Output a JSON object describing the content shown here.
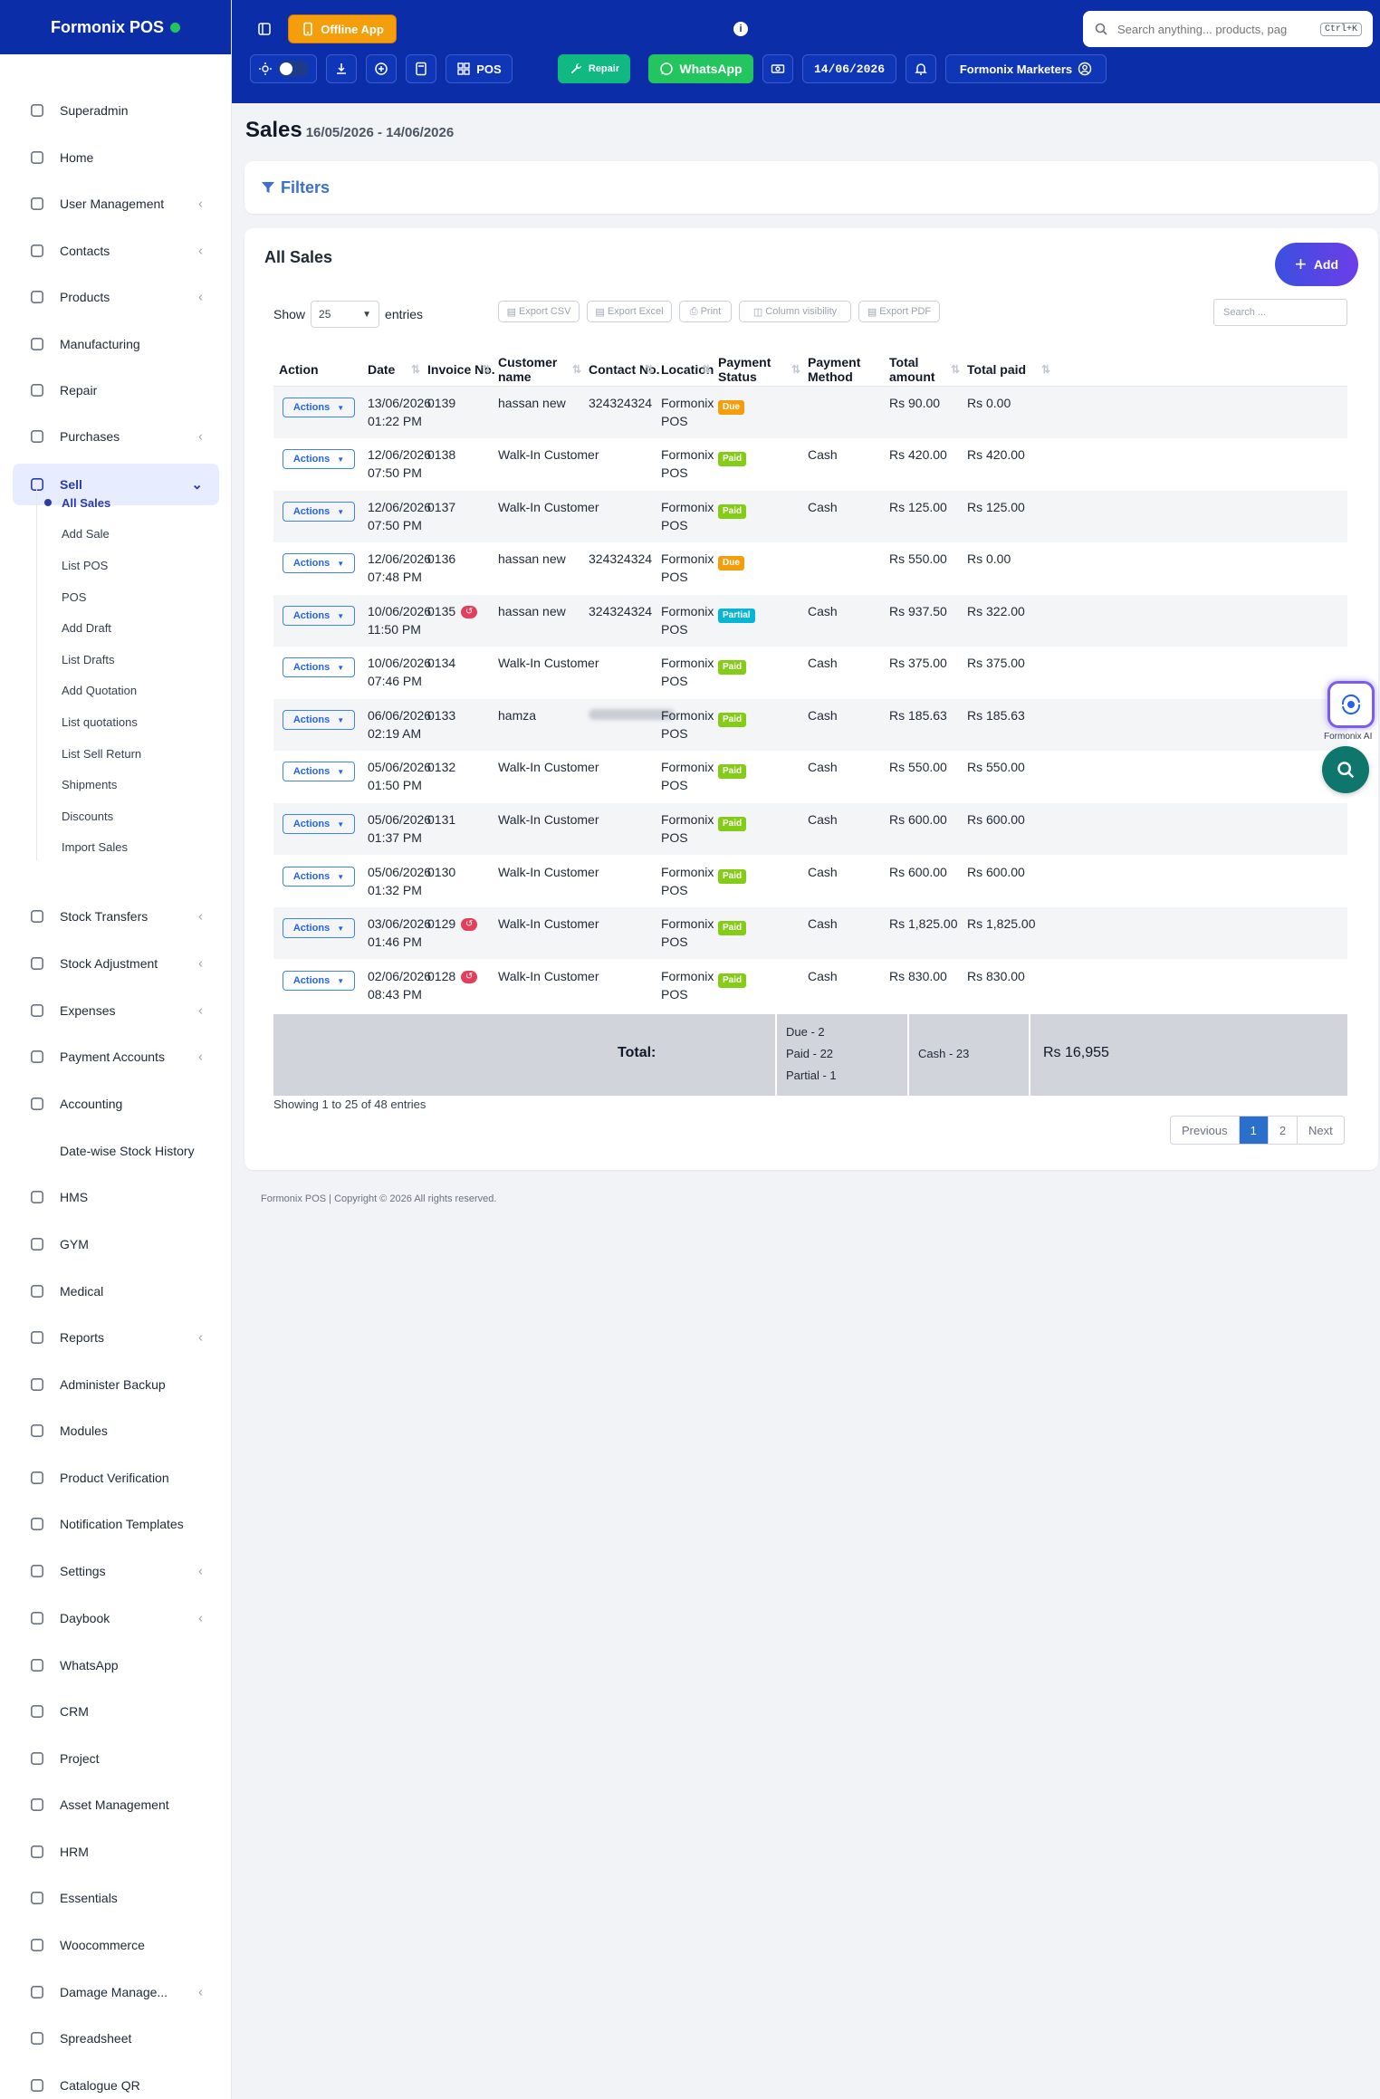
{
  "brand": "Formonix POS",
  "sidebar": {
    "items": [
      {
        "label": "Superadmin",
        "icon": "user-icon",
        "chev": false
      },
      {
        "label": "Home",
        "icon": "home-icon",
        "chev": false
      },
      {
        "label": "User Management",
        "icon": "users-icon",
        "chev": true
      },
      {
        "label": "Contacts",
        "icon": "contacts-icon",
        "chev": true
      },
      {
        "label": "Products",
        "icon": "box-icon",
        "chev": true
      },
      {
        "label": "Manufacturing",
        "icon": "factory-icon",
        "chev": false
      },
      {
        "label": "Repair",
        "icon": "wrench-icon",
        "chev": false
      },
      {
        "label": "Purchases",
        "icon": "download-icon",
        "chev": true
      },
      {
        "label": "Sell",
        "icon": "anchor-icon",
        "chev": true
      },
      {
        "label": "Stock Transfers",
        "icon": "truck-icon",
        "chev": true
      },
      {
        "label": "Stock Adjustment",
        "icon": "database-icon",
        "chev": true
      },
      {
        "label": "Expenses",
        "icon": "receipt-icon",
        "chev": true
      },
      {
        "label": "Payment Accounts",
        "icon": "card-icon",
        "chev": true
      },
      {
        "label": "Accounting",
        "icon": "bank-icon",
        "chev": false
      },
      {
        "label": "Date-wise Stock History",
        "icon": "none",
        "chev": false
      },
      {
        "label": "HMS",
        "icon": "building-icon",
        "chev": false
      },
      {
        "label": "GYM",
        "icon": "dumbbell-icon",
        "chev": false
      },
      {
        "label": "Medical",
        "icon": "medical-icon",
        "chev": false
      },
      {
        "label": "Reports",
        "icon": "report-icon",
        "chev": true
      },
      {
        "label": "Administer Backup",
        "icon": "cloud-icon",
        "chev": false
      },
      {
        "label": "Modules",
        "icon": "layers-icon",
        "chev": false
      },
      {
        "label": "Product Verification",
        "icon": "grid-icon",
        "chev": false
      },
      {
        "label": "Notification Templates",
        "icon": "mail-icon",
        "chev": false
      },
      {
        "label": "Settings",
        "icon": "gear-icon",
        "chev": true
      },
      {
        "label": "Daybook",
        "icon": "book-icon",
        "chev": true
      },
      {
        "label": "WhatsApp",
        "icon": "whatsapp-icon",
        "chev": false
      },
      {
        "label": "CRM",
        "icon": "broadcast-icon",
        "chev": false
      },
      {
        "label": "Project",
        "icon": "project-icon",
        "chev": false
      },
      {
        "label": "Asset Management",
        "icon": "asset-icon",
        "chev": false
      },
      {
        "label": "HRM",
        "icon": "people-icon",
        "chev": false
      },
      {
        "label": "Essentials",
        "icon": "check-circle-icon",
        "chev": false
      },
      {
        "label": "Woocommerce",
        "icon": "wordpress-icon",
        "chev": false
      },
      {
        "label": "Damage Manage...",
        "icon": "warning-icon",
        "chev": true
      },
      {
        "label": "Spreadsheet",
        "icon": "sheet-icon",
        "chev": false
      },
      {
        "label": "Catalogue QR",
        "icon": "qr-icon",
        "chev": false
      }
    ],
    "sell_sub": [
      "All Sales",
      "Add Sale",
      "List POS",
      "POS",
      "Add Draft",
      "List Drafts",
      "Add Quotation",
      "List quotations",
      "List Sell Return",
      "Shipments",
      "Discounts",
      "Import Sales"
    ]
  },
  "topbar": {
    "offline_app": "Offline App",
    "pos": "POS",
    "repair": "Repair",
    "whatsapp": "WhatsApp",
    "date": "14/06/2026",
    "business": "Formonix Marketers",
    "search_placeholder": "Search anything... products, pag",
    "search_kbd": "Ctrl+K"
  },
  "page": {
    "title": "Sales",
    "range": "16/05/2026 - 14/06/2026",
    "filters": "Filters",
    "card_title": "All Sales",
    "add": "Add",
    "show": "Show",
    "entries_value": "25",
    "entries": "entries",
    "exports": [
      "Export CSV",
      "Export Excel",
      "Print",
      "Column visibility",
      "Export PDF"
    ],
    "table_search_placeholder": "Search ..."
  },
  "table": {
    "headers": [
      "Action",
      "Date",
      "Invoice No.",
      "Customer name",
      "Contact No.",
      "Location",
      "Payment Status",
      "Payment Method",
      "Total amount",
      "Total paid"
    ],
    "action_label": "Actions",
    "rows": [
      {
        "date1": "13/06/2026",
        "date2": "01:22 PM",
        "inv": "0139",
        "ret": false,
        "cust": "hassan new",
        "contact": "324324324",
        "blur": false,
        "loc1": "Formonix",
        "loc2": "POS",
        "status": "Due",
        "method": "",
        "total": "Rs 90.00",
        "paid": "Rs 0.00"
      },
      {
        "date1": "12/06/2026",
        "date2": "07:50 PM",
        "inv": "0138",
        "ret": false,
        "cust": "Walk-In Customer",
        "contact": "",
        "blur": false,
        "loc1": "Formonix",
        "loc2": "POS",
        "status": "Paid",
        "method": "Cash",
        "total": "Rs 420.00",
        "paid": "Rs 420.00"
      },
      {
        "date1": "12/06/2026",
        "date2": "07:50 PM",
        "inv": "0137",
        "ret": false,
        "cust": "Walk-In Customer",
        "contact": "",
        "blur": false,
        "loc1": "Formonix",
        "loc2": "POS",
        "status": "Paid",
        "method": "Cash",
        "total": "Rs 125.00",
        "paid": "Rs 125.00"
      },
      {
        "date1": "12/06/2026",
        "date2": "07:48 PM",
        "inv": "0136",
        "ret": false,
        "cust": "hassan new",
        "contact": "324324324",
        "blur": false,
        "loc1": "Formonix",
        "loc2": "POS",
        "status": "Due",
        "method": "",
        "total": "Rs 550.00",
        "paid": "Rs 0.00"
      },
      {
        "date1": "10/06/2026",
        "date2": "11:50 PM",
        "inv": "0135",
        "ret": true,
        "cust": "hassan new",
        "contact": "324324324",
        "blur": false,
        "loc1": "Formonix",
        "loc2": "POS",
        "status": "Partial",
        "method": "Cash",
        "total": "Rs 937.50",
        "paid": "Rs 322.00"
      },
      {
        "date1": "10/06/2026",
        "date2": "07:46 PM",
        "inv": "0134",
        "ret": false,
        "cust": "Walk-In Customer",
        "contact": "",
        "blur": false,
        "loc1": "Formonix",
        "loc2": "POS",
        "status": "Paid",
        "method": "Cash",
        "total": "Rs 375.00",
        "paid": "Rs 375.00"
      },
      {
        "date1": "06/06/2026",
        "date2": "02:19 AM",
        "inv": "0133",
        "ret": false,
        "cust": "hamza",
        "contact": "",
        "blur": true,
        "loc1": "Formonix",
        "loc2": "POS",
        "status": "Paid",
        "method": "Cash",
        "total": "Rs 185.63",
        "paid": "Rs 185.63"
      },
      {
        "date1": "05/06/2026",
        "date2": "01:50 PM",
        "inv": "0132",
        "ret": false,
        "cust": "Walk-In Customer",
        "contact": "",
        "blur": false,
        "loc1": "Formonix",
        "loc2": "POS",
        "status": "Paid",
        "method": "Cash",
        "total": "Rs 550.00",
        "paid": "Rs 550.00"
      },
      {
        "date1": "05/06/2026",
        "date2": "01:37 PM",
        "inv": "0131",
        "ret": false,
        "cust": "Walk-In Customer",
        "contact": "",
        "blur": false,
        "loc1": "Formonix",
        "loc2": "POS",
        "status": "Paid",
        "method": "Cash",
        "total": "Rs 600.00",
        "paid": "Rs 600.00"
      },
      {
        "date1": "05/06/2026",
        "date2": "01:32 PM",
        "inv": "0130",
        "ret": false,
        "cust": "Walk-In Customer",
        "contact": "",
        "blur": false,
        "loc1": "Formonix",
        "loc2": "POS",
        "status": "Paid",
        "method": "Cash",
        "total": "Rs 600.00",
        "paid": "Rs 600.00"
      },
      {
        "date1": "03/06/2026",
        "date2": "01:46 PM",
        "inv": "0129",
        "ret": true,
        "cust": "Walk-In Customer",
        "contact": "",
        "blur": false,
        "loc1": "Formonix",
        "loc2": "POS",
        "status": "Paid",
        "method": "Cash",
        "total": "Rs 1,825.00",
        "paid": "Rs 1,825.00"
      },
      {
        "date1": "02/06/2026",
        "date2": "08:43 PM",
        "inv": "0128",
        "ret": true,
        "cust": "Walk-In Customer",
        "contact": "",
        "blur": false,
        "loc1": "Formonix",
        "loc2": "POS",
        "status": "Paid",
        "method": "Cash",
        "total": "Rs 830.00",
        "paid": "Rs 830.00"
      }
    ],
    "total_label": "Total:",
    "totals_status": [
      "Due - 2",
      "Paid - 22",
      "Partial - 1"
    ],
    "totals_method": "Cash - 23",
    "totals_amount": "Rs 16,955"
  },
  "pagination": {
    "info": "Showing 1 to 25 of 48 entries",
    "previous": "Previous",
    "pages": [
      "1",
      "2"
    ],
    "next": "Next"
  },
  "footer": "Formonix POS | Copyright © 2026 All rights reserved.",
  "ai_label": "Formonix AI",
  "colors": {
    "topbar": "#0b2ea8",
    "accent": "#2d3ba8",
    "due": "#f59e0b",
    "paid": "#84cc16",
    "partial": "#06b6d4",
    "whatsapp": "#22c55e",
    "repair": "#10b981",
    "offline": "#f59e0b"
  }
}
